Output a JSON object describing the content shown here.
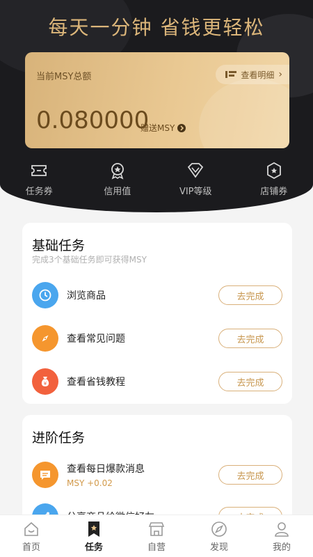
{
  "header": {
    "headline": "每天一分钟 省钱更轻松",
    "balance_label": "当前MSY总额",
    "detail_label": "查看明细",
    "balance_value": "0.080000",
    "gift_label": "赠送MSY"
  },
  "quick_items": [
    {
      "label": "任务券",
      "icon": "ticket-icon"
    },
    {
      "label": "信用值",
      "icon": "medal-icon"
    },
    {
      "label": "VIP等级",
      "icon": "diamond-icon"
    },
    {
      "label": "店铺券",
      "icon": "shop-hexagon-icon"
    }
  ],
  "basic": {
    "title": "基础任务",
    "subtitle": "完成3个基础任务即可获得MSY",
    "tasks": [
      {
        "name": "浏览商品",
        "button": "去完成",
        "icon": "clock-icon",
        "color": "#4aa6ee"
      },
      {
        "name": "查看常见问题",
        "button": "去完成",
        "icon": "compass-icon",
        "color": "#f5962e"
      },
      {
        "name": "查看省钱教程",
        "button": "去完成",
        "icon": "money-bag-icon",
        "color": "#f2613d"
      }
    ]
  },
  "advanced": {
    "title": "进阶任务",
    "tasks": [
      {
        "name": "查看每日爆款消息",
        "reward": "MSY +0.02",
        "button": "去完成",
        "icon": "message-icon",
        "color": "#f5962e"
      },
      {
        "name": "分享商品给微信好友",
        "reward": "",
        "button": "去完成",
        "icon": "share-icon",
        "color": "#4aa6ee"
      }
    ]
  },
  "tabs": [
    {
      "label": "首页",
      "icon": "home-icon",
      "active": false
    },
    {
      "label": "任务",
      "icon": "task-bookmark-icon",
      "active": true
    },
    {
      "label": "自营",
      "icon": "store-icon",
      "active": false
    },
    {
      "label": "发现",
      "icon": "compass-icon",
      "active": false
    },
    {
      "label": "我的",
      "icon": "user-icon",
      "active": false
    }
  ],
  "colors": {
    "gold": "#dcb67a",
    "dark": "#1b1b1e",
    "accent": "#d9b07a"
  }
}
